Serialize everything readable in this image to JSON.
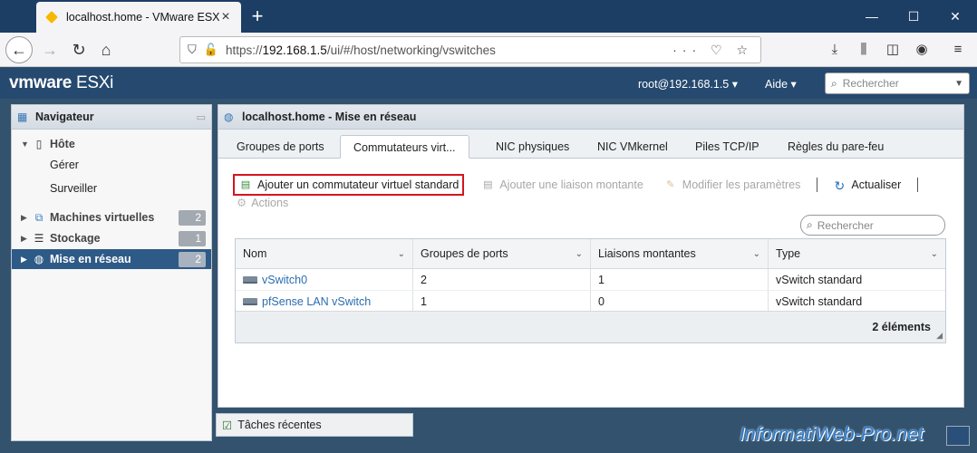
{
  "browser": {
    "tab_title": "localhost.home - VMware ESXi",
    "new_tab": "+",
    "url_prefix": "https://",
    "url_host": "192.168.1.5",
    "url_path": "/ui/#/host/networking/vswitches"
  },
  "esxi_header": {
    "logo_vm": "vmware",
    "logo_esxi": "ESXi",
    "user": "root@192.168.1.5 ▾",
    "help": "Aide ▾",
    "search_placeholder": "Rechercher"
  },
  "navigator": {
    "title": "Navigateur",
    "host": "Hôte",
    "host_children": [
      "Gérer",
      "Surveiller"
    ],
    "items": [
      {
        "label": "Machines virtuelles",
        "count": "2"
      },
      {
        "label": "Stockage",
        "count": "1"
      },
      {
        "label": "Mise en réseau",
        "count": "2"
      }
    ]
  },
  "main": {
    "title": "localhost.home - Mise en réseau",
    "tabs": [
      "Groupes de ports",
      "Commutateurs virt...",
      "NIC physiques",
      "NIC VMkernel",
      "Piles TCP/IP",
      "Règles du pare-feu"
    ],
    "toolbar": {
      "add_vswitch": "Ajouter un commutateur virtuel standard",
      "add_uplink": "Ajouter une liaison montante",
      "edit_settings": "Modifier les paramètres",
      "refresh": "Actualiser",
      "actions": "Actions"
    },
    "search_placeholder": "Rechercher",
    "table": {
      "headers": [
        "Nom",
        "Groupes de ports",
        "Liaisons montantes",
        "Type"
      ],
      "rows": [
        [
          "vSwitch0",
          "2",
          "1",
          "vSwitch standard"
        ],
        [
          "pfSense LAN vSwitch",
          "1",
          "0",
          "vSwitch standard"
        ]
      ],
      "footer_count": "2 éléments"
    }
  },
  "recent_tasks": "Tâches récentes",
  "watermark": "InformatiWeb-Pro.net"
}
